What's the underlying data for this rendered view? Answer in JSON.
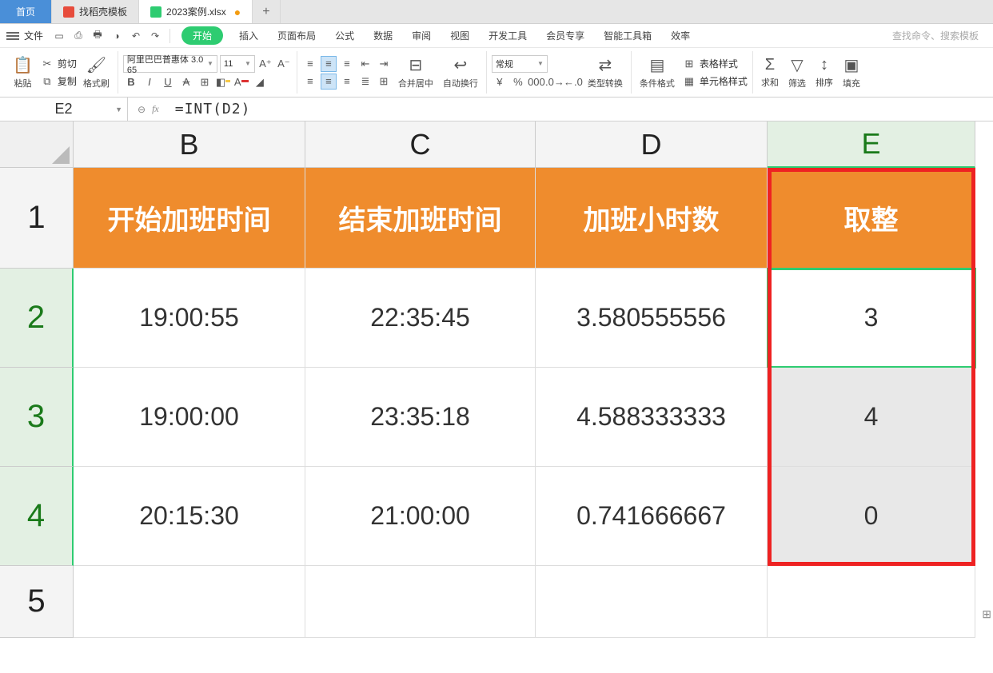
{
  "tabs": {
    "home": "首页",
    "t1": "找稻壳模板",
    "t2": "2023案例.xlsx",
    "add": "+"
  },
  "menu": {
    "file": "文件",
    "start_pill": "开始",
    "items": [
      "插入",
      "页面布局",
      "公式",
      "数据",
      "审阅",
      "视图",
      "开发工具",
      "会员专享",
      "智能工具箱",
      "效率"
    ],
    "search": "查找命令、搜索模板"
  },
  "ribbon": {
    "paste": "粘贴",
    "cut": "剪切",
    "copy": "复制",
    "format_painter": "格式刷",
    "font_name": "阿里巴巴普惠体 3.0 65",
    "font_size": "11",
    "merge": "合并居中",
    "wrap": "自动换行",
    "number_format": "常规",
    "type_convert": "类型转换",
    "cond_format": "条件格式",
    "table_style": "表格样式",
    "cell_style": "单元格样式",
    "sum": "求和",
    "filter": "筛选",
    "sort": "排序",
    "fill": "填充"
  },
  "fbar": {
    "name": "E2",
    "formula": "=INT(D2)"
  },
  "cols": [
    "B",
    "C",
    "D",
    "E"
  ],
  "rows": [
    "1",
    "2",
    "3",
    "4",
    "5"
  ],
  "table": {
    "headers": [
      "开始加班时间",
      "结束加班时间",
      "加班小时数",
      "取整"
    ],
    "data": [
      [
        "19:00:55",
        "22:35:45",
        "3.580555556",
        "3"
      ],
      [
        "19:00:00",
        "23:35:18",
        "4.588333333",
        "4"
      ],
      [
        "20:15:30",
        "21:00:00",
        "0.741666667",
        "0"
      ]
    ]
  }
}
